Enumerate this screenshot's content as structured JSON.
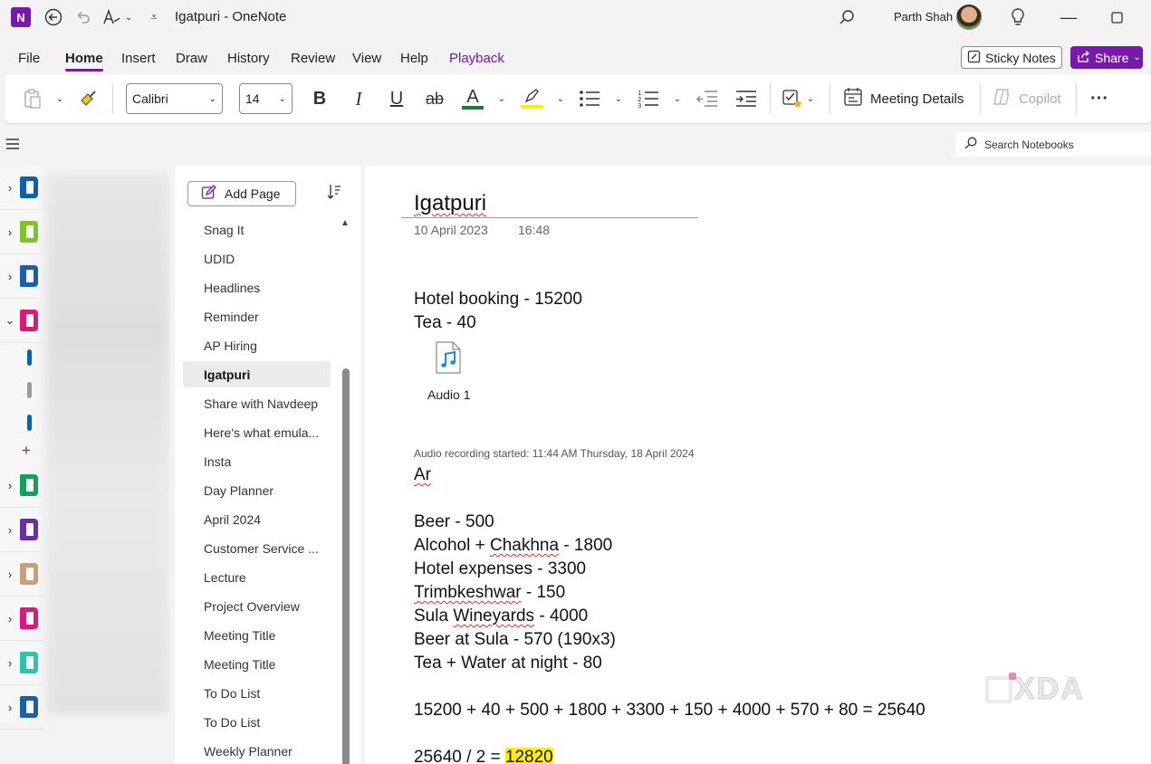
{
  "titlebar": {
    "app_logo": "N",
    "title": "Igatpuri  -  OneNote",
    "user_name": "Parth Shah",
    "icons": [
      "back-icon",
      "undo-icon",
      "ink-to-text-icon",
      "quick-access-dropdown-icon",
      "search-icon",
      "lightbulb-icon",
      "minimize-icon",
      "maximize-icon"
    ]
  },
  "menu": {
    "tabs": [
      "File",
      "Home",
      "Insert",
      "Draw",
      "History",
      "Review",
      "View",
      "Help",
      "Playback"
    ],
    "active": "Home",
    "sticky_notes": "Sticky Notes",
    "share": "Share"
  },
  "ribbon": {
    "font_name": "Calibri",
    "font_size": "14",
    "meeting_details": "Meeting Details",
    "copilot": "Copilot",
    "bold": "B",
    "italic": "I",
    "underline": "U",
    "strike": "ab",
    "font_color_letter": "A",
    "more": "···"
  },
  "search": {
    "placeholder": "Search Notebooks"
  },
  "notebooks": {
    "colors": [
      "#0f5fae",
      "#7cc42a",
      "#1a5fa8",
      "#e0177a",
      "#13a158",
      "#6b2fa3",
      "#c8a17a",
      "#e0177a",
      "#2ec2b0",
      "#1a5fa8"
    ],
    "section_tab_colors": [
      "#0f5fae",
      "#9a9a9a",
      "#0f5fae"
    ],
    "add_section": "+"
  },
  "pages": {
    "add_page": "Add Page",
    "items": [
      "Snag It",
      "UDID",
      "Headlines",
      "Reminder",
      "AP Hiring",
      "Igatpuri",
      "Share with Navdeep",
      "Here's what emula...",
      "Insta",
      "Day Planner",
      "April 2024",
      "Customer Service ...",
      "Lecture",
      "Project Overview",
      "Meeting Title",
      "Meeting Title",
      "To Do List",
      "To Do List",
      "Weekly Planner"
    ],
    "selected": "Igatpuri"
  },
  "note": {
    "title": "Igatpuri",
    "date": "10 April 2023",
    "time": "16:48",
    "line1": "Hotel booking - 15200",
    "line2": "Tea - 40",
    "audio_label": "Audio 1",
    "audio_meta": "Audio recording started: 11:44 AM Thursday, 18 April 2024",
    "ar": "Ar",
    "beer": "Beer - 500",
    "alcohol_a": "Alcohol + ",
    "alcohol_b": "Chakhna",
    "alcohol_c": " - 1800",
    "hotel_exp": "Hotel expenses - 3300",
    "trim_a": "Trimbkeshwar",
    "trim_b": " - 150",
    "sula_a": "Sula ",
    "sula_b": "Wineyards",
    "sula_c": " - 4000",
    "beer_sula": "Beer at Sula - 570 (190x3)",
    "tea_water": "Tea + Water at night - 80",
    "sum": "15200 + 40 + 500 + 1800 + 3300 + 150 + 4000 + 570 + 80 = 25640",
    "div_a": "25640 / 2 = ",
    "div_b": "12820"
  },
  "watermark": "XDA"
}
